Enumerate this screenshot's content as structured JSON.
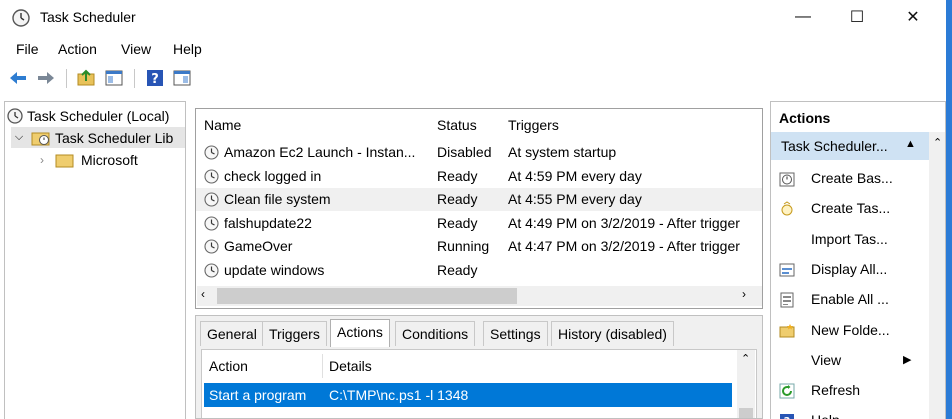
{
  "window": {
    "title": "Task Scheduler",
    "minimize": "—",
    "maximize": "☐",
    "close": "✕"
  },
  "menu": [
    "File",
    "Action",
    "View",
    "Help"
  ],
  "tree": {
    "root": "Task Scheduler (Local)",
    "library": "Task Scheduler Lib",
    "child": "Microsoft"
  },
  "tasks": {
    "headers": {
      "name": "Name",
      "status": "Status",
      "triggers": "Triggers"
    },
    "rows": [
      {
        "name": "Amazon Ec2 Launch - Instan...",
        "status": "Disabled",
        "trigger": "At system startup"
      },
      {
        "name": "check logged in",
        "status": "Ready",
        "trigger": "At 4:59 PM every day"
      },
      {
        "name": "Clean file system",
        "status": "Ready",
        "trigger": "At 4:55 PM every day"
      },
      {
        "name": "falshupdate22",
        "status": "Ready",
        "trigger": "At 4:49 PM on 3/2/2019 - After trigger"
      },
      {
        "name": "GameOver",
        "status": "Running",
        "trigger": "At 4:47 PM on 3/2/2019 - After trigger"
      },
      {
        "name": "update windows",
        "status": "Ready",
        "trigger": ""
      }
    ],
    "selected_index": 2
  },
  "detail": {
    "tabs": [
      "General",
      "Triggers",
      "Actions",
      "Conditions",
      "Settings",
      "History (disabled)"
    ],
    "active_tab": "Actions",
    "headers": {
      "action": "Action",
      "details": "Details"
    },
    "row": {
      "action": "Start a program",
      "details": "C:\\TMP\\nc.ps1 -l 1348"
    }
  },
  "actions_pane": {
    "title": "Actions",
    "section": "Task Scheduler...",
    "items": [
      {
        "label": "Create Bas...",
        "icon": "create-basic-task-icon"
      },
      {
        "label": "Create Tas...",
        "icon": "create-task-icon"
      },
      {
        "label": "Import Tas...",
        "icon": ""
      },
      {
        "label": "Display All...",
        "icon": "display-all-icon"
      },
      {
        "label": "Enable All ...",
        "icon": "enable-all-icon"
      },
      {
        "label": "New Folde...",
        "icon": "new-folder-icon"
      },
      {
        "label": "View",
        "icon": ""
      },
      {
        "label": "Refresh",
        "icon": "refresh-icon"
      },
      {
        "label": "Help",
        "icon": "help-icon"
      }
    ]
  },
  "colors": {
    "selection": "#0078d7",
    "section_header": "#cfe2f3",
    "window_border": "#2b7bd6"
  }
}
